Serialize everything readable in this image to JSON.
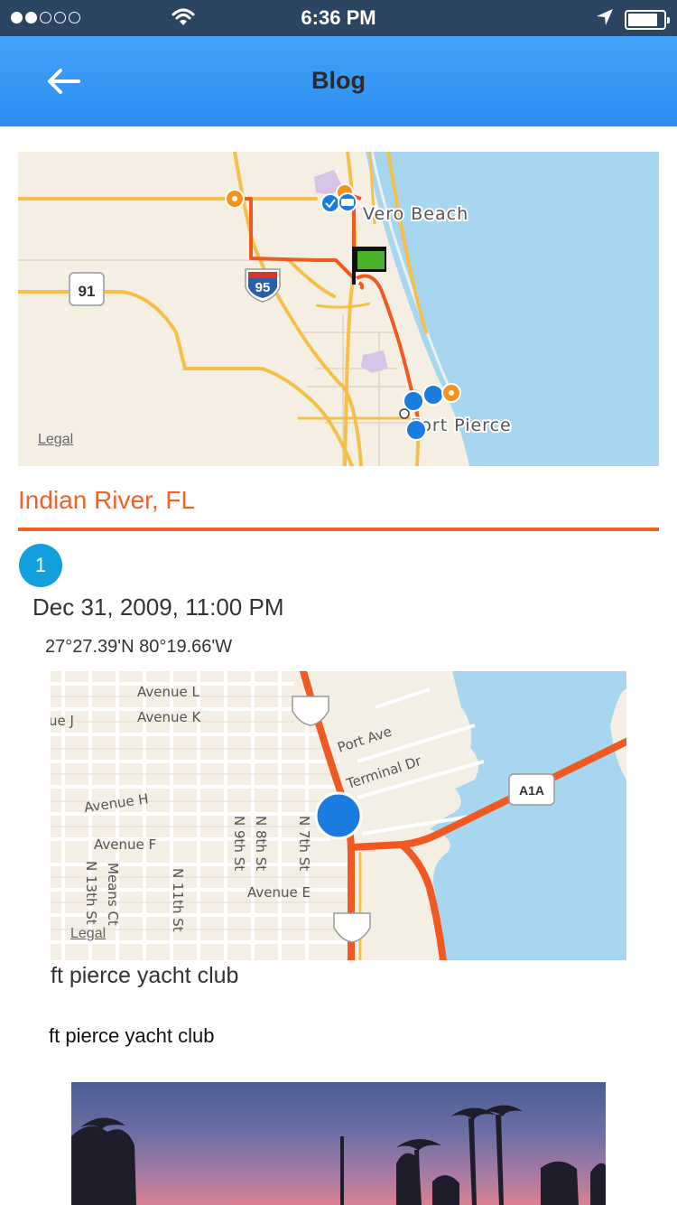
{
  "status_bar": {
    "signal_dots_filled": 2,
    "signal_dots_total": 5,
    "time": "6:36 PM",
    "icons": [
      "wifi-icon",
      "location-arrow-icon",
      "battery-icon"
    ],
    "battery_level": 0.85
  },
  "nav": {
    "title": "Blog",
    "back_icon": "arrow-left-icon"
  },
  "overview_map": {
    "labels": {
      "vero": "Vero Beach",
      "fort": "Fort Pierce",
      "shield_95": "95",
      "shield_91": "91",
      "legal": "Legal"
    },
    "icons": [
      "green-flag-icon",
      "orange-pin-icon",
      "blue-location-dot-icon"
    ]
  },
  "section": {
    "title": "Indian River, FL",
    "accent_color": "#f0622a"
  },
  "entry": {
    "number": "1",
    "date": "Dec 31, 2009, 11:00 PM",
    "coordinates": "27°27.39'N 80°19.66'W",
    "caption": "ft pierce yacht club",
    "body": "ft pierce yacht club"
  },
  "detail_map": {
    "labels": {
      "avenue_l": "Avenue L",
      "avenue_k": "Avenue K",
      "avenue_j": "ue J",
      "avenue_h": "Avenue H",
      "avenue_f": "Avenue F",
      "avenue_e": "Avenue E",
      "port_ave": "Port Ave",
      "terminal_dr": "Terminal Dr",
      "n9th": "N 9th St",
      "n8th": "N 8th St",
      "n7th": "N 7th St",
      "n13th": "N 13th St",
      "means": "Means Ct",
      "n11th": "N 11th St",
      "a1a": "A1A",
      "legal": "Legal"
    }
  }
}
